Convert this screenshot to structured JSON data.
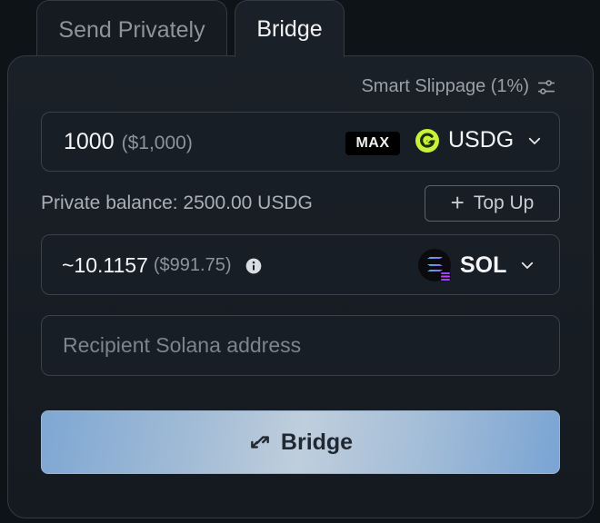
{
  "tabs": {
    "send_privately": "Send Privately",
    "bridge": "Bridge"
  },
  "slippage": {
    "label": "Smart Slippage (1%)"
  },
  "send": {
    "amount": "1000",
    "usd_value": "($1,000)",
    "max_label": "MAX",
    "token": "USDG"
  },
  "balance": {
    "text": "Private balance: 2500.00 USDG",
    "topup_label": "Top Up"
  },
  "receive": {
    "amount": "~10.1157",
    "usd_value": "($991.75)",
    "token": "SOL"
  },
  "recipient": {
    "placeholder": "Recipient Solana address"
  },
  "action": {
    "label": "Bridge"
  },
  "colors": {
    "accent_gradient_start": "#7ea7d3",
    "accent_gradient_mid": "#bfcedc",
    "usdg_logo": "#c8f23a",
    "background": "#0e1318",
    "card": "#1a2027"
  },
  "icons": {
    "slippage": "sliders-icon",
    "token_chevron": "chevron-down-icon",
    "info": "info-icon",
    "bridge": "swap-arrows-icon"
  }
}
